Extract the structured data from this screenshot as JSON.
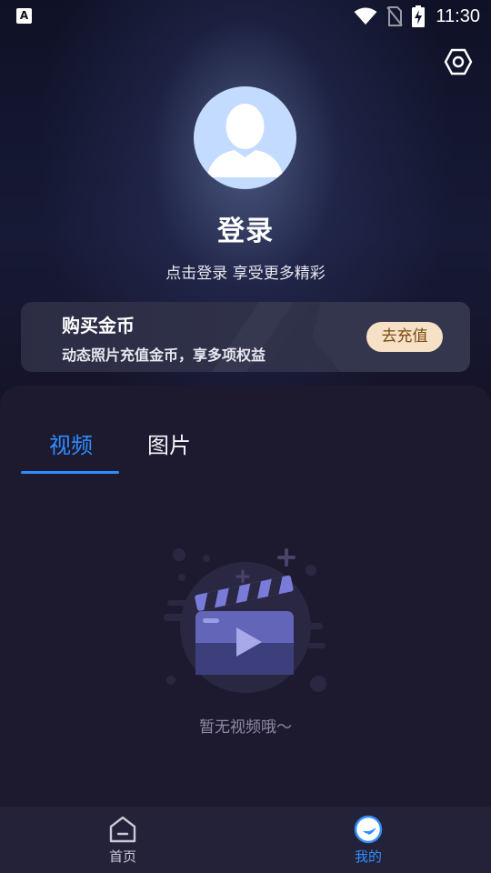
{
  "status_bar": {
    "app_icon": "A",
    "time": "11:30",
    "icons": [
      "wifi-icon",
      "no-sim-icon",
      "battery-charging-icon"
    ]
  },
  "header": {
    "settings_icon": "settings-hexagon-icon",
    "avatar_icon": "user-avatar-icon",
    "login_title": "登录",
    "login_subtitle": "点击登录 享受更多精彩"
  },
  "coin_card": {
    "title": "购买金币",
    "description": "动态照片充值金币，享多项权益",
    "button_label": "去充值"
  },
  "tabs": [
    {
      "label": "视频",
      "active": true
    },
    {
      "label": "图片",
      "active": false
    }
  ],
  "empty_state": {
    "icon": "video-clapperboard-icon",
    "text": "暂无视频哦～"
  },
  "bottom_nav": [
    {
      "label": "首页",
      "icon": "home-icon",
      "active": false
    },
    {
      "label": "我的",
      "icon": "profile-icon",
      "active": true
    }
  ],
  "colors": {
    "accent": "#2f8cff",
    "background": "#141226",
    "panel": "#1d1a30",
    "recharge_button": "#f6e1c6"
  }
}
